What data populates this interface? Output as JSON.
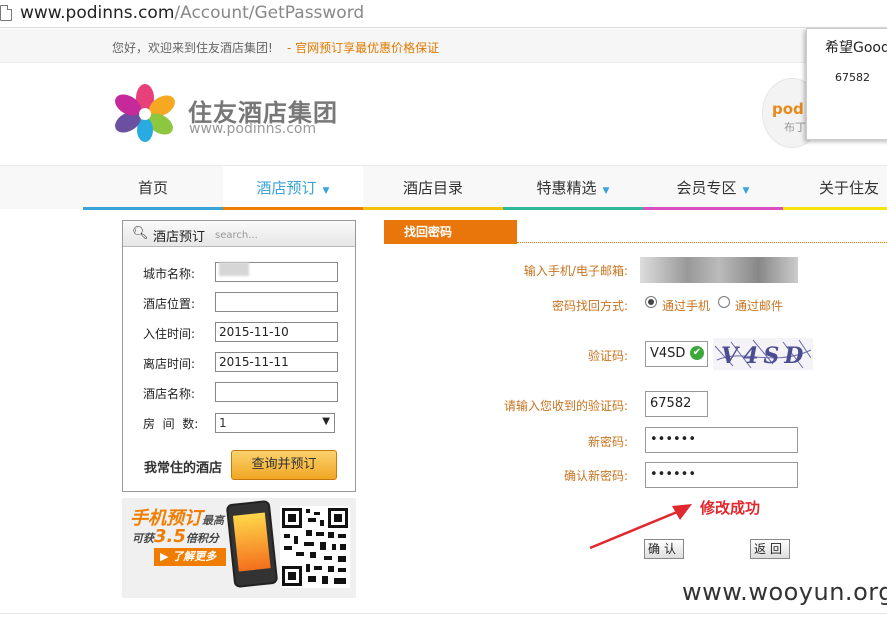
{
  "browser": {
    "url_host": "www.podinns.com",
    "url_path": "/Account/GetPassword"
  },
  "topbar": {
    "welcome": "您好，欢迎来到住友酒店集团!",
    "promo": "- 官网预订享最优惠价格保证"
  },
  "brand": {
    "name": "住友酒店集团",
    "url": "www.podinns.com"
  },
  "popup": {
    "title": "希望Good",
    "code": "67582",
    "badge_text": "pod",
    "badge_sub": "布丁"
  },
  "nav": {
    "items": [
      {
        "label": "首页",
        "has_caret": false,
        "bar_color": "#3aa3d8"
      },
      {
        "label": "酒店预订",
        "has_caret": true,
        "bar_color": "#f07d00"
      },
      {
        "label": "酒店目录",
        "has_caret": false,
        "bar_color": "#f4c20d"
      },
      {
        "label": "特惠精选",
        "has_caret": true,
        "bar_color": "#2fb89b"
      },
      {
        "label": "会员专区",
        "has_caret": true,
        "bar_color": "#d94fc2"
      },
      {
        "label": "关于住友",
        "has_caret": false,
        "bar_color": "#f4e30d"
      }
    ],
    "caret": "▼"
  },
  "booking": {
    "title": "酒店预订",
    "search_hint": "search...",
    "search_icon": "magnifier-icon",
    "fields": [
      {
        "label": "城市名称:",
        "value": ""
      },
      {
        "label": "酒店位置:",
        "value": ""
      },
      {
        "label": "入住时间:",
        "value": "2015-11-10"
      },
      {
        "label": "离店时间:",
        "value": "2015-11-11"
      },
      {
        "label": "酒店名称:",
        "value": ""
      }
    ],
    "rooms_label": "房  间  数:",
    "rooms_value": "1",
    "favorite_label": "我常住的酒店",
    "query_button": "查询并预订"
  },
  "banner": {
    "line1": "手机预订",
    "line1_small": "最高",
    "line2_prefix": "可获",
    "line2_number": "3.5",
    "line2_suffix": "倍积分",
    "button": "▶ 了解更多"
  },
  "form": {
    "tab": "找回密码",
    "rows": {
      "account_label": "输入手机/电子邮箱:",
      "method_label": "密码找回方式:",
      "method_phone": "通过手机",
      "method_email": "通过邮件",
      "captcha_label": "验证码:",
      "captcha_value": "V4SD",
      "captcha_image_text": "V4SD",
      "sms_label": "请输入您收到的验证码:",
      "sms_value": "67582",
      "new_pw_label": "新密码:",
      "new_pw_value": "••••••",
      "confirm_pw_label": "确认新密码:",
      "confirm_pw_value": "••••••"
    },
    "success": "修改成功",
    "confirm_button": "确认",
    "back_button": "返回"
  },
  "watermark": "www.wooyun.org",
  "colors": {
    "accent_orange": "#e8760a",
    "nav_active": "#3aa3d8",
    "label_brown": "#c7731e",
    "success_red": "#e0282e"
  }
}
